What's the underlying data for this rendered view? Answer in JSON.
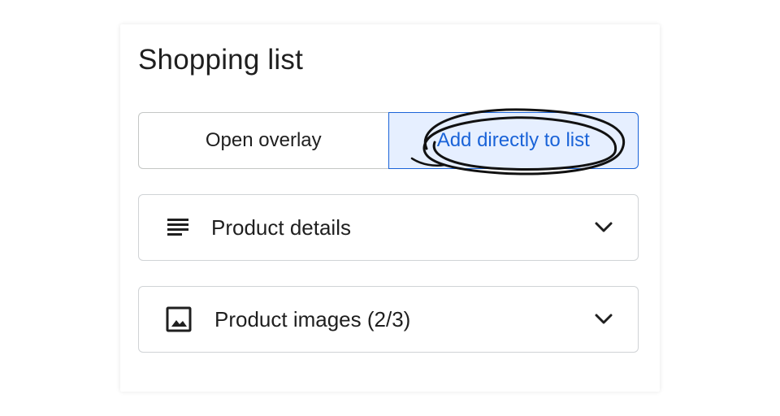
{
  "panel": {
    "title": "Shopping list"
  },
  "toggle": {
    "options": [
      {
        "label": "Open overlay",
        "selected": false
      },
      {
        "label": "Add directly to list",
        "selected": true
      }
    ]
  },
  "accordions": [
    {
      "label": "Product details",
      "icon": "text-lines-icon",
      "state": "collapsed"
    },
    {
      "label": "Product images (2/3)",
      "icon": "image-icon",
      "state": "collapsed"
    }
  ],
  "colors": {
    "accent": "#1a63d8",
    "selected_bg": "#e6efff",
    "border": "#d0d3d6",
    "text": "#1f1f1f"
  }
}
